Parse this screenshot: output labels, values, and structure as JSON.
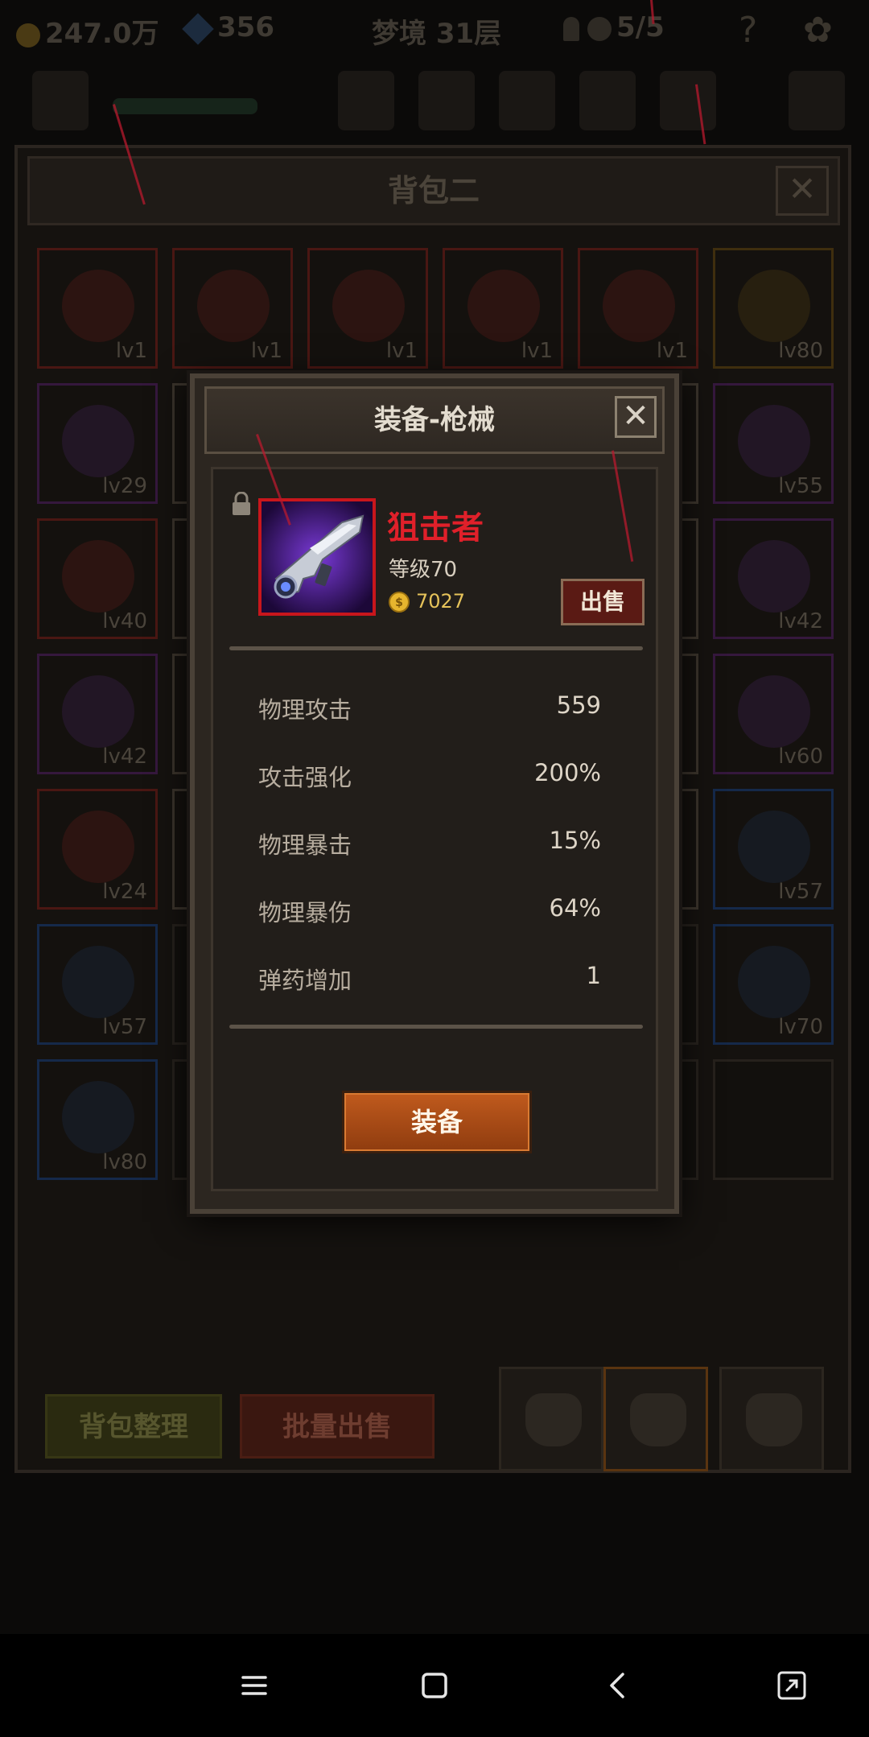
{
  "top_bar": {
    "gold": "247.0万",
    "gems": "356",
    "stage": "梦境 31层",
    "keys": "5/5"
  },
  "bag": {
    "title": "背包二",
    "close_symbol": "✕",
    "slots": [
      {
        "level": "lv1",
        "rarity": "red"
      },
      {
        "level": "lv1",
        "rarity": "red"
      },
      {
        "level": "lv1",
        "rarity": "red"
      },
      {
        "level": "lv1",
        "rarity": "red"
      },
      {
        "level": "lv1",
        "rarity": "red"
      },
      {
        "level": "lv80",
        "rarity": "gold"
      },
      {
        "level": "lv29",
        "rarity": "purple"
      },
      {
        "level": "lv55",
        "rarity": "purple"
      },
      {
        "level": "lv40",
        "rarity": "red"
      },
      {
        "level": "lv42",
        "rarity": "purple"
      },
      {
        "level": "lv42",
        "rarity": "purple"
      },
      {
        "level": "lv60",
        "rarity": "purple"
      },
      {
        "level": "lv24",
        "rarity": "red"
      },
      {
        "level": "lv57",
        "rarity": "blue"
      },
      {
        "level": "lv57",
        "rarity": "blue"
      },
      {
        "level": "lv70",
        "rarity": "blue"
      },
      {
        "level": "lv80",
        "rarity": "blue"
      }
    ],
    "sort_button": "背包整理",
    "bulk_sell_button": "批量出售"
  },
  "dialog": {
    "title": "装备-枪械",
    "close_symbol": "✕",
    "item": {
      "name": "狙击者",
      "level_text": "等级70",
      "price": "7027",
      "coin_symbol": "$",
      "name_color": "#e0202a"
    },
    "sell_button": "出售",
    "stats": [
      {
        "label": "物理攻击",
        "value": "559"
      },
      {
        "label": "攻击强化",
        "value": "200%"
      },
      {
        "label": "物理暴击",
        "value": "15%"
      },
      {
        "label": "物理暴伤",
        "value": "64%"
      },
      {
        "label": "弹药增加",
        "value": "1"
      }
    ],
    "equip_button": "装备"
  },
  "nav_icons": [
    "menu-icon",
    "home-icon",
    "back-icon",
    "fullscreen-icon"
  ]
}
